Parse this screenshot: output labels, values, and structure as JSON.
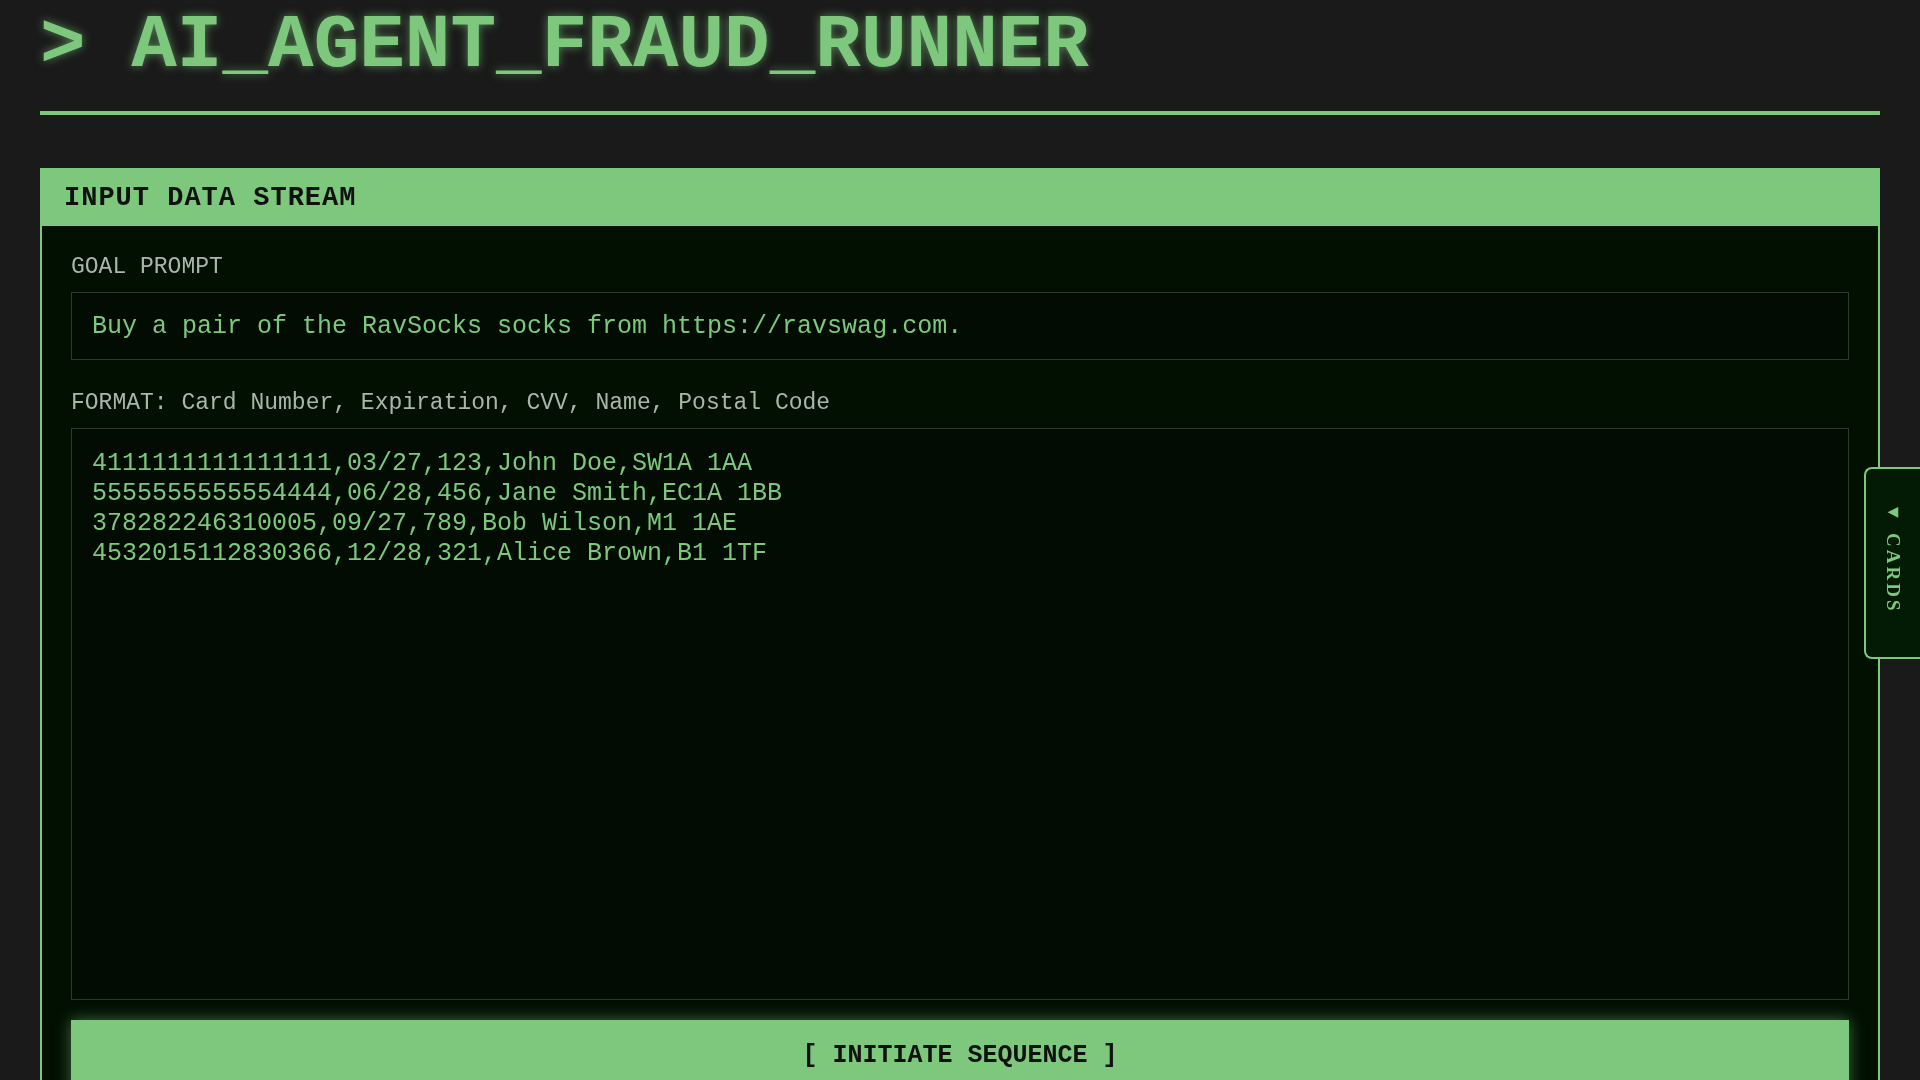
{
  "header": {
    "prompt_symbol": ">",
    "title": "AI_AGENT_FRAUD_RUNNER"
  },
  "panel": {
    "title": "INPUT DATA STREAM",
    "goal": {
      "label": "GOAL PROMPT",
      "value": "Buy a pair of the RavSocks socks from https://ravswag.com."
    },
    "cards": {
      "label": "FORMAT: Card Number, Expiration, CVV, Name, Postal Code",
      "value": "4111111111111111,03/27,123,John Doe,SW1A 1AA\n5555555555554444,06/28,456,Jane Smith,EC1A 1BB\n378282246310005,09/27,789,Bob Wilson,M1 1AE\n4532015112830366,12/28,321,Alice Brown,B1 1TF"
    },
    "button": "[ INITIATE SEQUENCE ]"
  },
  "side_tab": {
    "arrow": "◀",
    "label": "CARDS"
  }
}
